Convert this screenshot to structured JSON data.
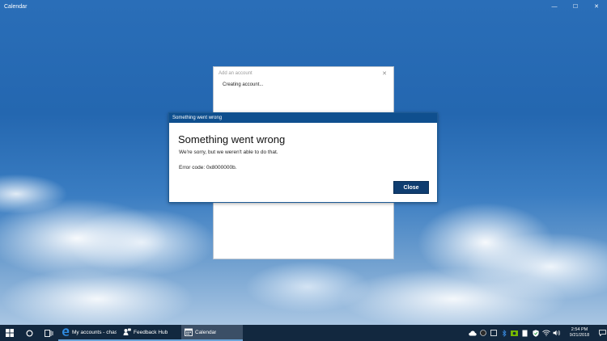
{
  "window": {
    "app_title": "Calendar",
    "controls": {
      "minimize": "—",
      "maximize": "☐",
      "close": "✕"
    }
  },
  "add_account_dialog": {
    "title": "Add an account",
    "close_glyph": "✕",
    "status": "Creating account..."
  },
  "error_dialog": {
    "bar_title": "Something went wrong",
    "heading": "Something went wrong",
    "message": "We're sorry, but we weren't able to do that.",
    "error_code": "Error code: 0x8000000b.",
    "close_label": "Close"
  },
  "taskbar": {
    "apps": [
      {
        "label": "My accounts - chas...",
        "icon": "edge-icon",
        "active": false
      },
      {
        "label": "Feedback Hub",
        "icon": "feedback-hub-icon",
        "active": false
      },
      {
        "label": "Calendar",
        "icon": "calendar-icon",
        "active": true
      }
    ],
    "tray": {
      "time": "2:54 PM",
      "date": "9/21/2018"
    }
  },
  "colors": {
    "dialog_bar": "#0f4f8e",
    "close_button": "#0f3d70",
    "taskbar": "#12283f",
    "taskbar_active": "#3b4f66"
  }
}
